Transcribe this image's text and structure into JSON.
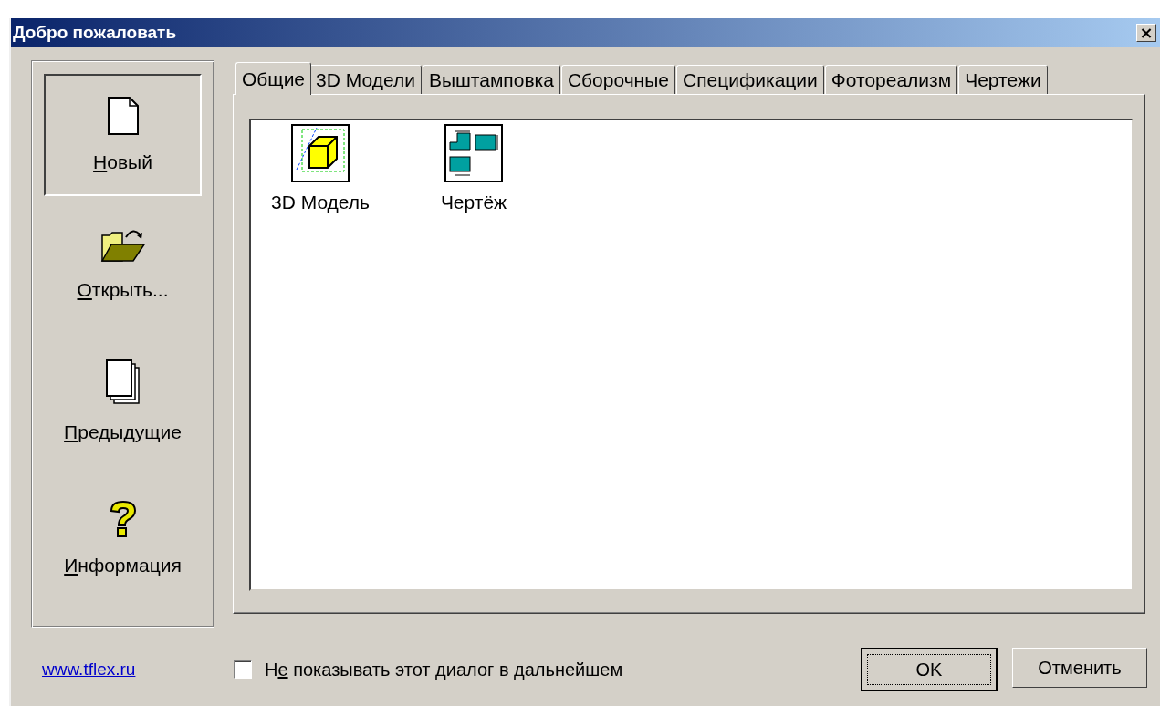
{
  "window": {
    "title": "Добро пожаловать",
    "close": "×"
  },
  "sidebar": {
    "items": [
      {
        "kind": "new",
        "selected": true,
        "label": [
          {
            "text": "Н",
            "underline": true
          },
          {
            "text": "овый",
            "underline": false
          }
        ]
      },
      {
        "kind": "open",
        "selected": false,
        "label": [
          {
            "text": "О",
            "underline": true
          },
          {
            "text": "ткрыть...",
            "underline": false
          }
        ]
      },
      {
        "kind": "recent",
        "selected": false,
        "label": [
          {
            "text": "П",
            "underline": true
          },
          {
            "text": "редыдущие",
            "underline": false
          }
        ]
      },
      {
        "kind": "info",
        "selected": false,
        "label": [
          {
            "text": "И",
            "underline": true
          },
          {
            "text": "нформация",
            "underline": false
          }
        ]
      }
    ]
  },
  "tabs": [
    {
      "label": "Общие",
      "selected": true
    },
    {
      "label": "3D Модели",
      "selected": false
    },
    {
      "label": "Выштамповка",
      "selected": false
    },
    {
      "label": "Сборочные",
      "selected": false
    },
    {
      "label": "Спецификации",
      "selected": false
    },
    {
      "label": "Фотореализм",
      "selected": false
    },
    {
      "label": "Чертежи",
      "selected": false
    }
  ],
  "templates": [
    {
      "kind": "model",
      "label": "3D Модель"
    },
    {
      "kind": "drawing",
      "label": "Чертёж"
    }
  ],
  "footer": {
    "link": "www.tflex.ru",
    "checkbox": {
      "checked": false,
      "label": [
        {
          "text": "Н",
          "underline": false
        },
        {
          "text": "е",
          "underline": true
        },
        {
          "text": " показывать этот диалог в дальнейшем",
          "underline": false
        }
      ]
    },
    "buttons": [
      {
        "label": "OK",
        "default": true
      },
      {
        "label": "Отменить",
        "default": false
      }
    ]
  }
}
